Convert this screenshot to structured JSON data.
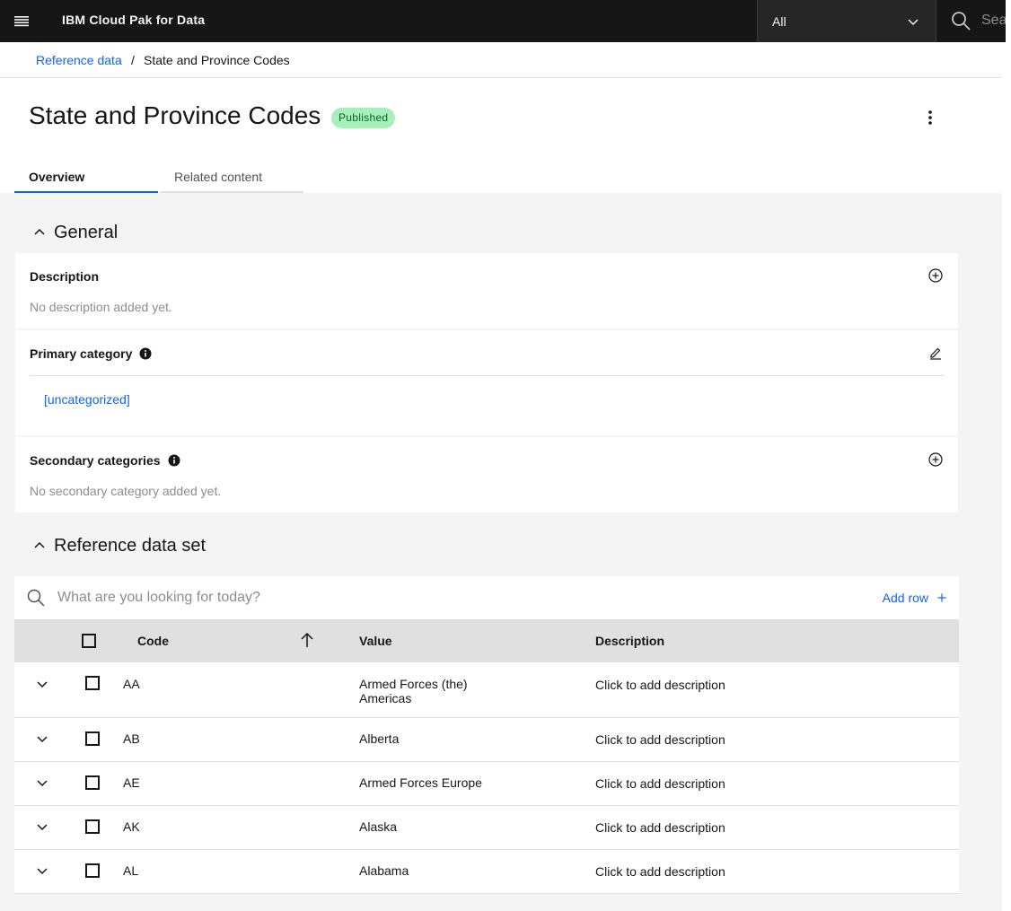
{
  "header": {
    "product_name": "IBM Cloud Pak for Data",
    "scope_value": "All",
    "search_placeholder": "Search"
  },
  "breadcrumb": {
    "parent": "Reference data",
    "separator": "/",
    "current": "State and Province Codes"
  },
  "page": {
    "title": "State and Province Codes",
    "status": "Published"
  },
  "tabs": [
    {
      "label": "Overview",
      "selected": true
    },
    {
      "label": "Related content",
      "selected": false
    }
  ],
  "general": {
    "heading": "General",
    "description_label": "Description",
    "description_empty": "No description added yet.",
    "primary_category_label": "Primary category",
    "primary_category_value": "[uncategorized]",
    "secondary_categories_label": "Secondary categories",
    "secondary_categories_empty": "No secondary category added yet."
  },
  "reference_set": {
    "heading": "Reference data set",
    "search_placeholder": "What are you looking for today?",
    "add_row_label": "Add row",
    "columns": [
      "Code",
      "Value",
      "Description"
    ],
    "rows": [
      {
        "code": "AA",
        "value": "Armed Forces (the) Americas",
        "description": "Click to add description"
      },
      {
        "code": "AB",
        "value": "Alberta",
        "description": "Click to add description"
      },
      {
        "code": "AE",
        "value": "Armed Forces Europe",
        "description": "Click to add description"
      },
      {
        "code": "AK",
        "value": "Alaska",
        "description": "Click to add description"
      },
      {
        "code": "AL",
        "value": "Alabama",
        "description": "Click to add description"
      }
    ]
  },
  "colors": {
    "accent": "#0f62fe",
    "header_bg": "#161616",
    "tag_bg": "#a7f0ba",
    "tag_text": "#0e6027"
  }
}
